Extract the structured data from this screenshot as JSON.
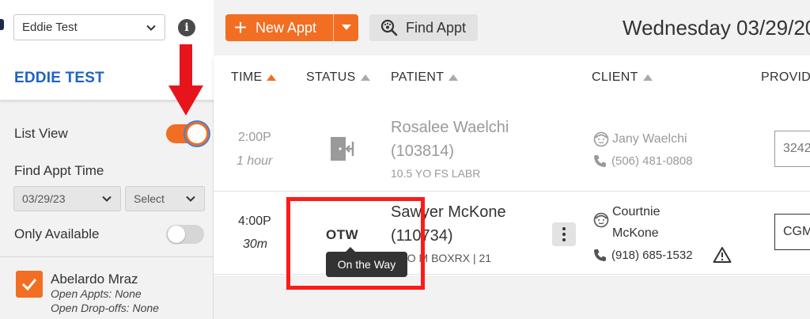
{
  "sidebar": {
    "clinic_select_value": "Eddie Test",
    "clinic_title": "EDDIE TEST",
    "list_view_label": "List View",
    "find_appt_time_label": "Find Appt Time",
    "date_select_value": "03/29/23",
    "time_select_value": "Select",
    "only_available_label": "Only Available",
    "provider": {
      "name": "Abelardo Mraz",
      "open_appts": "Open Appts: None",
      "open_dropoffs": "Open Drop-offs: None"
    },
    "list_view_on": true,
    "only_available_on": false
  },
  "toolbar": {
    "new_appt_label": "New Appt",
    "find_appt_label": "Find Appt",
    "date_heading": "Wednesday 03/29/20"
  },
  "table": {
    "headers": [
      "TIME",
      "STATUS",
      "PATIENT",
      "CLIENT",
      "PROVID"
    ],
    "rows": [
      {
        "time": "2:00P",
        "duration": "1 hour",
        "status_icon": "checkout-door-icon",
        "patient_name": "Rosalee Waelchi",
        "patient_id": "(103814)",
        "patient_detail": "10.5 YO FS LABR",
        "client_name": "Jany Waelchi",
        "client_phone": "(506) 481-0808",
        "provider_code": "3242"
      },
      {
        "time": "4:00P",
        "duration": "30m",
        "status": "OTW",
        "status_tooltip": "On the Way",
        "patient_name": "Sawyer McKone",
        "patient_id": "(110734)",
        "patient_detail": "4 YO M BOXRX | 21",
        "client_name_line1": "Courtnie",
        "client_name_line2": "McKone",
        "client_phone": "(918) 685-1532",
        "provider_code": "CGM"
      }
    ]
  },
  "colors": {
    "accent": "#f26e22",
    "link_blue": "#1e63c4",
    "highlight_red": "#ff1a1a"
  }
}
